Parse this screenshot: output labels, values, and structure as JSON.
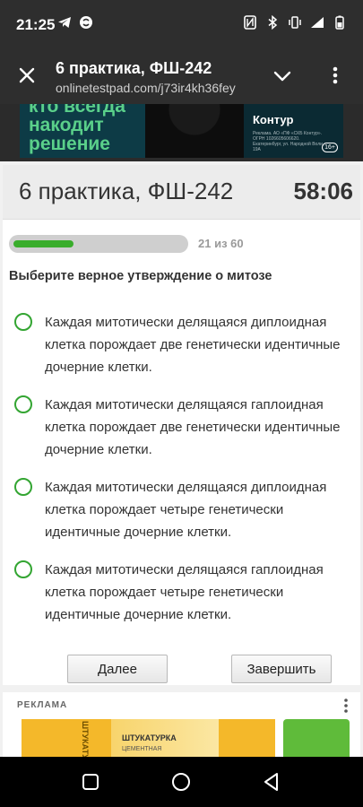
{
  "status": {
    "time": "21:25"
  },
  "topbar": {
    "title": "6 практика, ФШ-242",
    "url": "onlinetestpad.com/j73ir4kh36fey"
  },
  "banner": {
    "slogan": "кто всегда накодит решение",
    "brand": "Контур",
    "fine_print": "Реклама. АО «ПФ «СКБ Контур». ОГРН 1026605606620. Екатеринбург, ул. Народной Воли, 19А",
    "age": "16+"
  },
  "test": {
    "title": "6 практика, ФШ-242",
    "timer": "58:06",
    "progress_text": "21 из 60",
    "progress_fraction": 0.35,
    "question": "Выберите верное утверждение о митозе",
    "options": [
      "Каждая митотически делящаяся диплоидная клетка порождает две генетически идентичные дочерние клетки.",
      "Каждая митотически делящаяся гаплоидная клетка порождает две генетически идентичные дочерние клетки.",
      "Каждая митотически делящаяся диплоидная клетка порождает четыре генетически идентичные дочерние клетки.",
      "Каждая митотически делящаяся гаплоидная клетка порождает четыре генетически идентичные дочерние клетки."
    ],
    "next_label": "Далее",
    "finish_label": "Завершить"
  },
  "ad": {
    "label": "РЕКЛАМА",
    "product_label": "ШТУКАТУРКА",
    "product_sub": "ЦЕМЕНТНАЯ",
    "vertical_text": "ШТУКАТУРКА"
  },
  "colors": {
    "accent_green": "#39ad2b",
    "radio_green": "#33a532",
    "dark_bar": "#2e2e2e"
  }
}
